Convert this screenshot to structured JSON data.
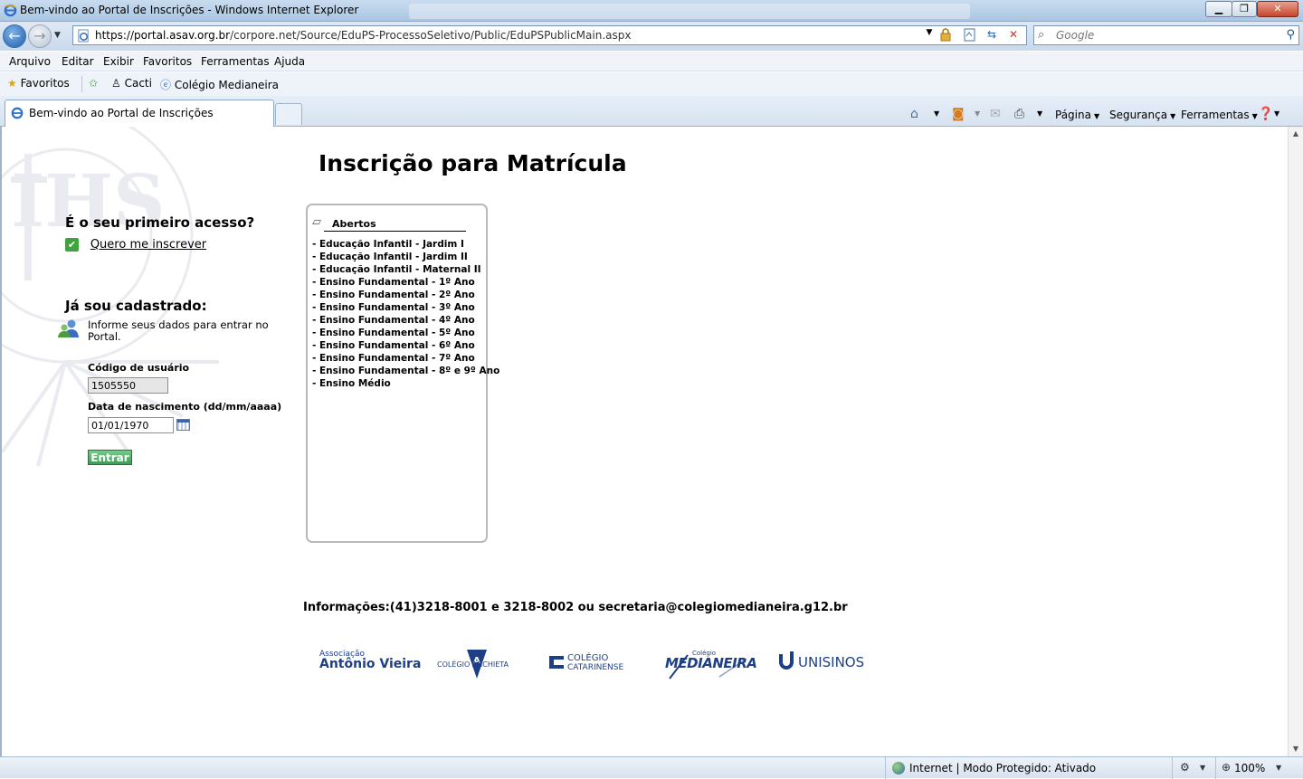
{
  "window": {
    "title": "Bem-vindo ao Portal de Inscrições - Windows Internet Explorer",
    "min_glyph": "▁",
    "max_glyph": "❐",
    "close_glyph": "✕"
  },
  "address": {
    "url_domain": "https://portal.asav.org.br",
    "url_path": "/corpore.net/Source/EduPS-ProcessoSeletivo/Public/EduPSPublicMain.aspx",
    "search_placeholder": "Google"
  },
  "menu": {
    "items": [
      "Arquivo",
      "Editar",
      "Exibir",
      "Favoritos",
      "Ferramentas",
      "Ajuda"
    ]
  },
  "favorites_bar": {
    "favorites_label": "Favoritos",
    "links": [
      "Cacti",
      "Colégio Medianeira"
    ]
  },
  "tabs": [
    {
      "label": "Bem-vindo ao Portal de Inscrições",
      "active": true
    }
  ],
  "command_bar": {
    "page": "Página",
    "security": "Segurança",
    "tools": "Ferramentas"
  },
  "page": {
    "title": "Inscrição para Matrícula",
    "first_access": {
      "heading": "É o seu primeiro acesso?",
      "signup_link": "Quero me inscrever"
    },
    "login": {
      "heading": "Já sou cadastrado:",
      "info": "Informe seus dados para entrar no Portal.",
      "user_code_label": "Código de usuário",
      "user_code_value": "1505550",
      "birth_label": "Data de nascimento (dd/mm/aaaa)",
      "birth_value": "01/01/1970",
      "submit_label": "Entrar"
    },
    "open_panel": {
      "title": "Abertos",
      "items": [
        "- Educação Infantil - Jardim I",
        "- Educação Infantil - Jardim II",
        "- Educação Infantil - Maternal II",
        "- Ensino Fundamental - 1º Ano",
        "- Ensino Fundamental - 2º Ano",
        "- Ensino Fundamental - 3º Ano",
        "- Ensino Fundamental - 4º Ano",
        "- Ensino Fundamental - 5º Ano",
        "- Ensino Fundamental - 6º Ano",
        "- Ensino Fundamental - 7º Ano",
        "- Ensino Fundamental - 8º e 9º Ano",
        "- Ensino Médio"
      ]
    },
    "contact": "Informações:(41)3218-8001 e 3218-8002 ou secretaria@colegiomedianeira.g12.br",
    "logos": {
      "av_small": "Associação",
      "av_big": "Antônio Vieira",
      "anchieta": "COLÉGIO ANCHIETA",
      "catarinense_a": "COLÉGIO",
      "catarinense_b": "CATARINENSE",
      "medianeira_a": "Colégio",
      "medianeira_b": "MEDIANEIRA",
      "unisinos": "UNISINOS"
    }
  },
  "status": {
    "zone": "Internet | Modo Protegido: Ativado",
    "zoom": "100%"
  },
  "colors": {
    "enter_button": "#3e9c55",
    "logo_blue": "#1d3f86",
    "ie_chrome": "#c8d9ec"
  }
}
